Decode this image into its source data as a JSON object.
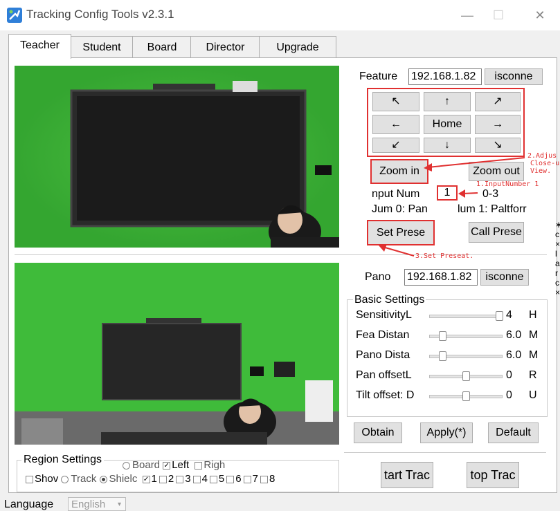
{
  "window": {
    "title": "Tracking Config Tools v2.3.1",
    "min": "—",
    "max": "☐",
    "close": "✕"
  },
  "tabs": [
    "Teacher",
    "Student",
    "Board",
    "Director",
    "Upgrade"
  ],
  "feature": {
    "label": "Feature",
    "ip": "192.168.1.82",
    "disconnect": "isconne",
    "ptz": {
      "ul": "↖",
      "up": "↑",
      "ur": "↗",
      "left": "←",
      "home": "Home",
      "right": "→",
      "dl": "↙",
      "down": "↓",
      "dr": "↘"
    },
    "zoom_in": "Zoom in",
    "zoom_out": "Zoom out",
    "input_num_label": "nput Num",
    "input_num_value": "1",
    "range": "0-3",
    "num0": "Jum 0: Pan",
    "num1": "lum 1: Paltforr",
    "set_preset": "Set Prese",
    "call_preset": "Call Prese"
  },
  "annotations": {
    "a1": "1.InputNumber 1",
    "a2_1": "2.Adjus",
    "a2_2": "Close-u",
    "a2_3": "View.",
    "a3": "3.Set Preseat."
  },
  "pano": {
    "label": "Pano",
    "ip": "192.168.1.82",
    "disconnect": "isconne"
  },
  "basic": {
    "title": "Basic Settings",
    "rows": [
      {
        "label": "SensitivityL",
        "value": "4",
        "unit": "H",
        "pos": 1.0
      },
      {
        "label": "Fea Distan",
        "value": "6.0",
        "unit": "M",
        "pos": 0.15
      },
      {
        "label": "Pano Dista",
        "value": "6.0",
        "unit": "M",
        "pos": 0.15
      },
      {
        "label": "Pan offsetL",
        "value": "0",
        "unit": "R",
        "pos": 0.5
      },
      {
        "label": "Tilt offset: D",
        "value": "0",
        "unit": "U",
        "pos": 0.5
      }
    ]
  },
  "buttons": {
    "obtain": "Obtain",
    "apply": "Apply(*)",
    "default": "Default",
    "start": "tart Trac",
    "stop": "top Trac"
  },
  "region": {
    "title": "Region Settings",
    "show": "Shov",
    "board": "Board",
    "left": "Left",
    "right": "Righ",
    "track": "Track",
    "shield": "Shielc",
    "nums": [
      "1",
      "2",
      "3",
      "4",
      "5",
      "6",
      "7",
      "8"
    ]
  },
  "language": {
    "label": "Language",
    "value": "English"
  },
  "side_glyphs": [
    "∗",
    "c",
    "×",
    "l",
    "a",
    "r",
    "c",
    "×"
  ]
}
